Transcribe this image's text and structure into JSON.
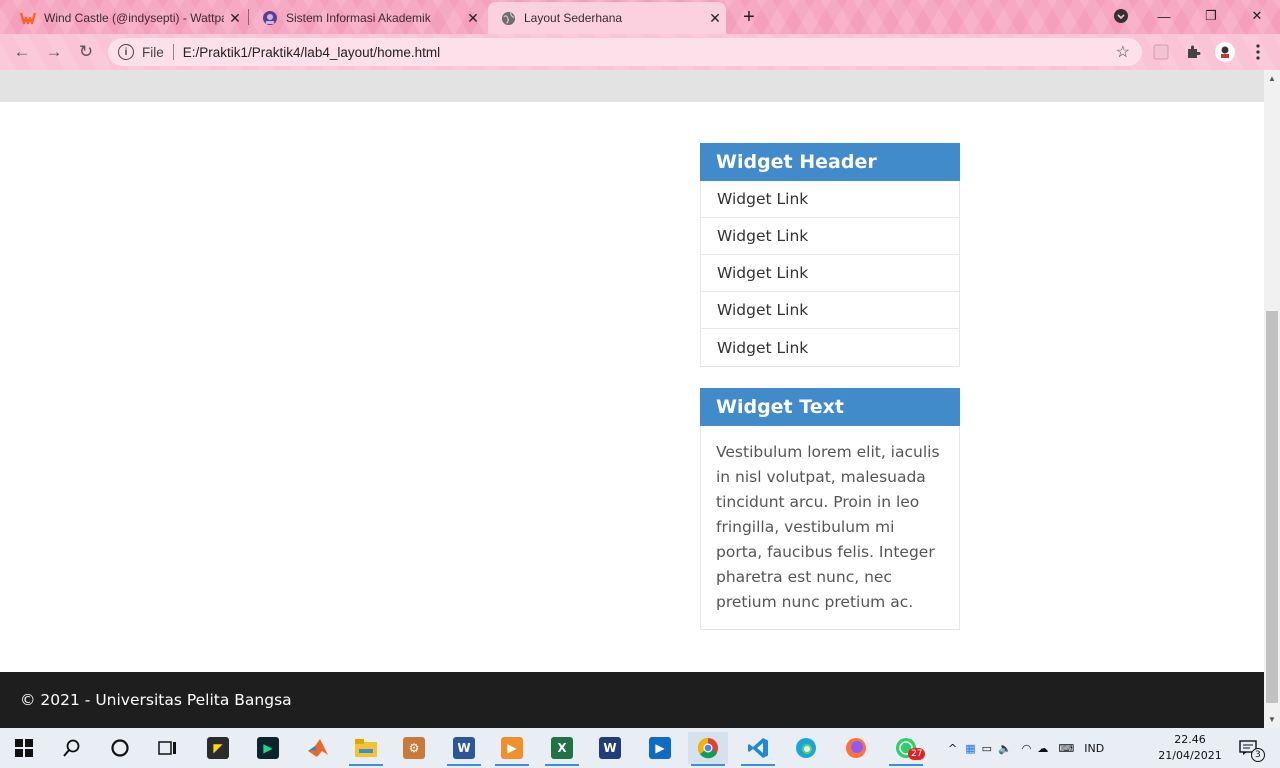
{
  "browser": {
    "tabs": [
      {
        "title": "Wind Castle (@indysepti) - Wattpad",
        "favicon": "wattpad-icon",
        "active": false
      },
      {
        "title": "Sistem Informasi Akademik",
        "favicon": "akademik-icon",
        "active": false
      },
      {
        "title": "Layout Sederhana",
        "favicon": "globe-icon",
        "active": true
      }
    ],
    "address": {
      "scheme": "File",
      "url": "E:/Praktik1/Praktik4/lab4_layout/home.html"
    }
  },
  "page": {
    "widget_links": {
      "header": "Widget Header",
      "links": [
        "Widget Link",
        "Widget Link",
        "Widget Link",
        "Widget Link",
        "Widget Link"
      ]
    },
    "widget_text": {
      "header": "Widget Text",
      "body": "Vestibulum lorem elit, iaculis in nisl volutpat, malesuada tincidunt arcu. Proin in leo fringilla, vestibulum mi porta, faucibus felis. Integer pharetra est nunc, nec pretium nunc pretium ac."
    },
    "footer": "© 2021 - Universitas Pelita Bangsa"
  },
  "taskbar": {
    "language": "IND",
    "time": "22.46",
    "date": "21/04/2021",
    "whatsapp_badge": "27",
    "notification_count": "3"
  },
  "colors": {
    "widget_header": "#428bca",
    "footer": "#1e1e1e",
    "tabbar": "#f7a9c4"
  }
}
